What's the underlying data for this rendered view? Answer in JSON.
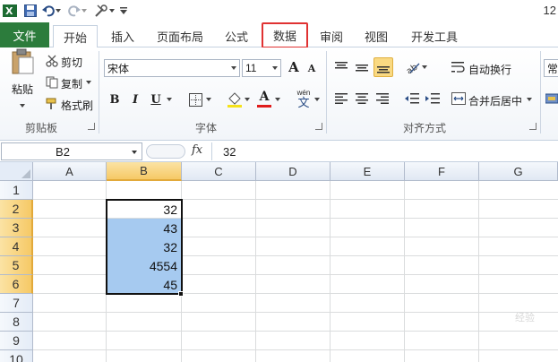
{
  "title_bar": {
    "partial_text": "12"
  },
  "tabs": {
    "file": "文件",
    "home": "开始",
    "insert": "插入",
    "page_layout": "页面布局",
    "formulas": "公式",
    "data": "数据",
    "review": "审阅",
    "view": "视图",
    "developer": "开发工具"
  },
  "ribbon": {
    "clipboard": {
      "paste": "粘贴",
      "cut": "剪切",
      "copy": "复制",
      "format_painter": "格式刷",
      "group_label": "剪贴板"
    },
    "font": {
      "font_name": "宋体",
      "font_size": "11",
      "bold": "B",
      "italic": "I",
      "underline": "U",
      "grow": "A",
      "shrink": "A",
      "font_color": "A",
      "phonetic": "wén",
      "phonetic_char": "文",
      "group_label": "字体"
    },
    "alignment": {
      "wrap_text": "自动换行",
      "merge_center": "合并后居中",
      "group_label": "对齐方式"
    },
    "number": {
      "partial_label": "常"
    }
  },
  "formula_bar": {
    "name_box": "B2",
    "fx": "fx",
    "value": "32"
  },
  "sheet": {
    "columns": [
      "A",
      "B",
      "C",
      "D",
      "E",
      "F",
      "G"
    ],
    "rows": [
      "1",
      "2",
      "3",
      "4",
      "5",
      "6",
      "7",
      "8",
      "9",
      "10"
    ],
    "values": {
      "B2": "32",
      "B3": "43",
      "B4": "32",
      "B5": "4554",
      "B6": "45"
    },
    "selection": "B2:B6"
  },
  "watermark": "经验",
  "colors": {
    "file_tab": "#2c7c3c",
    "highlight_box": "#e03232",
    "selected_cells": "#a6caf0",
    "selected_header": "#f6c966"
  }
}
